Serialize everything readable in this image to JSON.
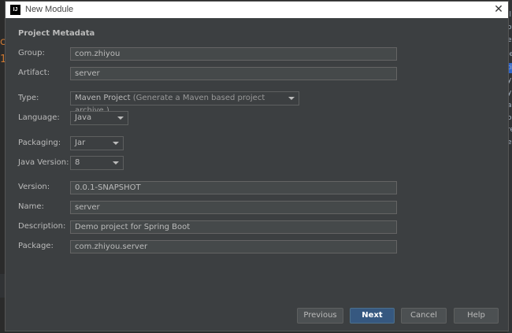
{
  "background": {
    "left_fragments": [
      "c",
      "1"
    ],
    "right_fragments": [
      "il",
      "oy",
      "e",
      "ie",
      "ti",
      "yl",
      "yl",
      "ar",
      "oc",
      "re",
      "en"
    ]
  },
  "dialog": {
    "title": "New Module",
    "app_icon_text": "IJ",
    "close_glyph": "✕",
    "section_title": "Project Metadata"
  },
  "form": {
    "group": {
      "label": "Group:",
      "value": "com.zhiyou"
    },
    "artifact": {
      "label": "Artifact:",
      "value": "server"
    },
    "type": {
      "label": "Type:",
      "value": "Maven Project",
      "hint": "(Generate a Maven based project archive.)"
    },
    "language": {
      "label": "Language:",
      "value": "Java"
    },
    "packaging": {
      "label": "Packaging:",
      "value": "Jar"
    },
    "java_version": {
      "label": "Java Version:",
      "value": "8"
    },
    "version": {
      "label": "Version:",
      "value": "0.0.1-SNAPSHOT"
    },
    "name": {
      "label": "Name:",
      "value": "server"
    },
    "description": {
      "label": "Description:",
      "value": "Demo project for Spring Boot"
    },
    "package": {
      "label": "Package:",
      "value": "com.zhiyou.server"
    }
  },
  "buttons": {
    "previous": "Previous",
    "next": "Next",
    "cancel": "Cancel",
    "help": "Help"
  },
  "colors": {
    "dialog_bg": "#3c3f41",
    "field_bg": "#45494a",
    "primary_button": "#365880",
    "text": "#bbbbbb"
  }
}
